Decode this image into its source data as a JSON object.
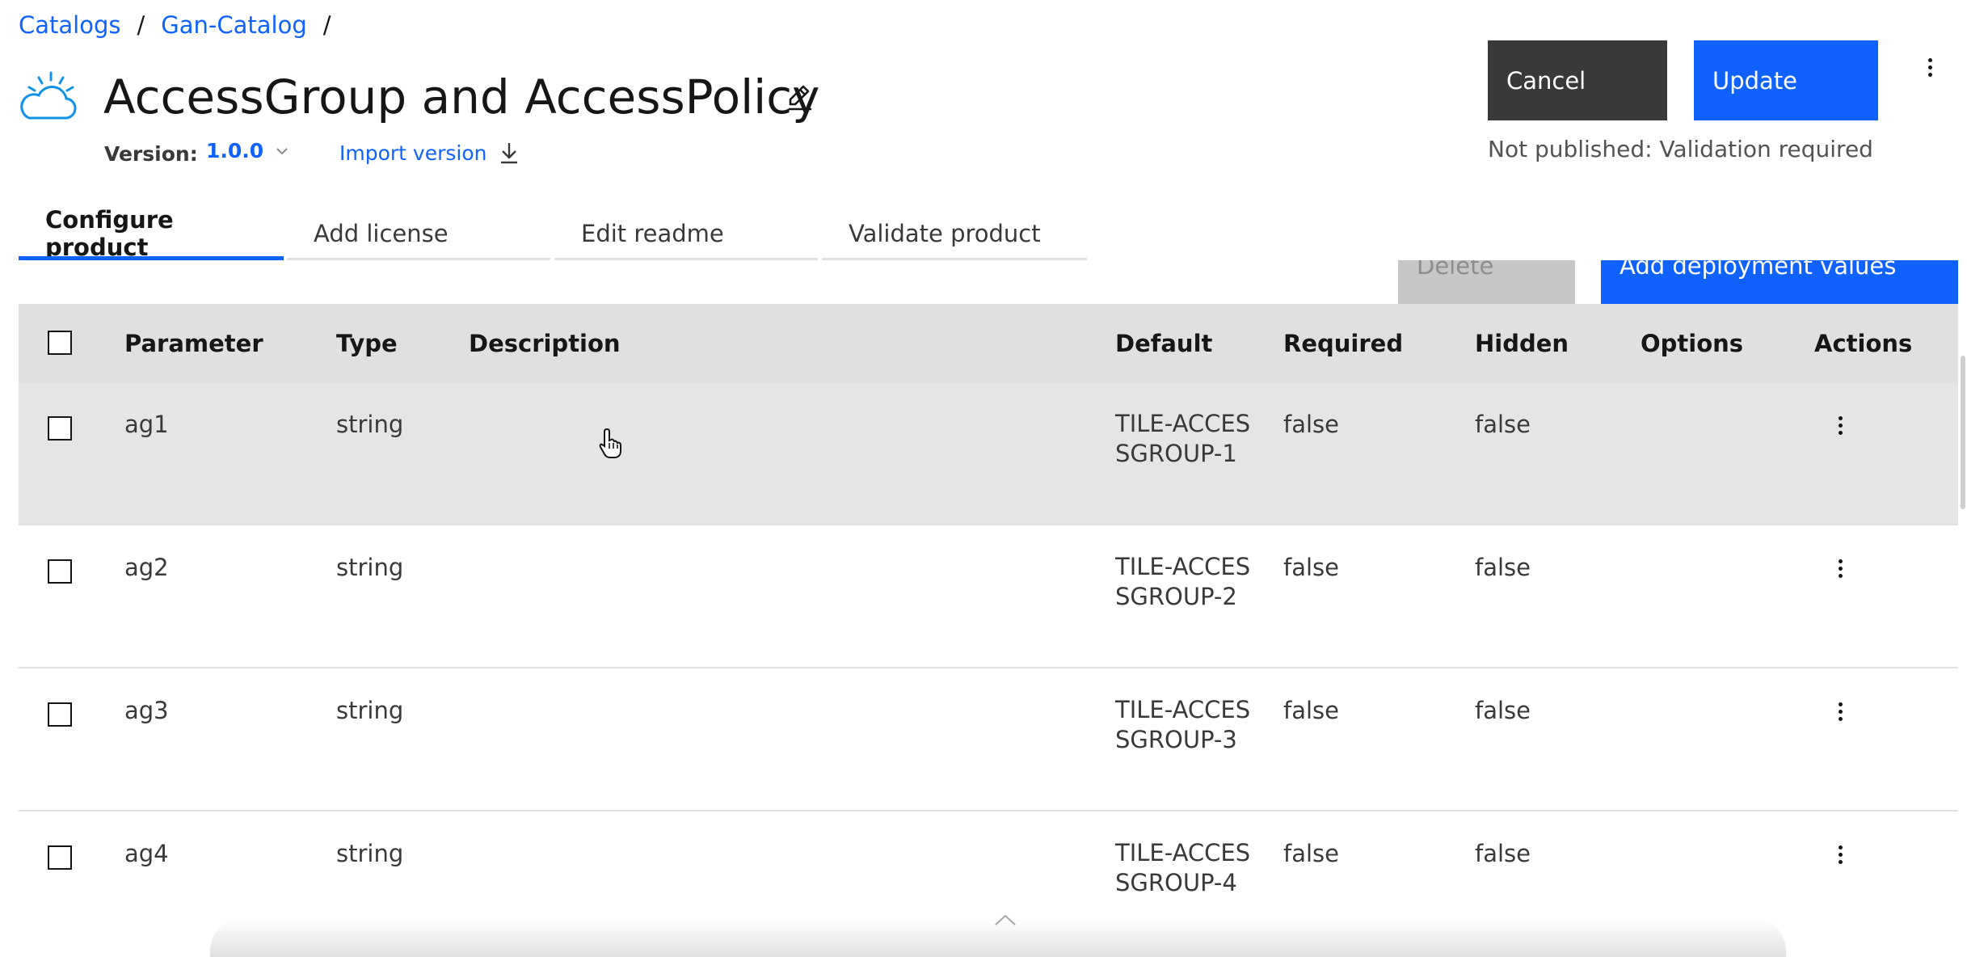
{
  "breadcrumb": {
    "items": [
      "Catalogs",
      "Gan-Catalog"
    ],
    "separator": "/"
  },
  "product": {
    "title": "AccessGroup and AccessPolicy",
    "version_label": "Version:",
    "version_value": "1.0.0",
    "import_version": "Import version"
  },
  "actions": {
    "cancel": "Cancel",
    "update": "Update",
    "status": "Not published: Validation required"
  },
  "tabs": [
    "Configure product",
    "Add license",
    "Edit readme",
    "Validate product"
  ],
  "toolbar": {
    "delete": "Delete",
    "add_deployment_values": "Add deployment values"
  },
  "table": {
    "columns": [
      "Parameter",
      "Type",
      "Description",
      "Default",
      "Required",
      "Hidden",
      "Options",
      "Actions"
    ],
    "rows": [
      {
        "parameter": "ag1",
        "type": "string",
        "description": "",
        "default": "TILE-ACCESSGROUP-1",
        "required": "false",
        "hidden": "false",
        "options": ""
      },
      {
        "parameter": "ag2",
        "type": "string",
        "description": "",
        "default": "TILE-ACCESSGROUP-2",
        "required": "false",
        "hidden": "false",
        "options": ""
      },
      {
        "parameter": "ag3",
        "type": "string",
        "description": "",
        "default": "TILE-ACCESSGROUP-3",
        "required": "false",
        "hidden": "false",
        "options": ""
      },
      {
        "parameter": "ag4",
        "type": "string",
        "description": "",
        "default": "TILE-ACCESSGROUP-4",
        "required": "false",
        "hidden": "false",
        "options": ""
      }
    ]
  },
  "colors": {
    "primary": "#0f62fe",
    "secondary": "#393939",
    "disabled": "#c6c6c6",
    "header_bg": "#e0e0e0",
    "hover_bg": "#e5e5e5"
  },
  "icons": [
    "cloud-icon",
    "edit-icon",
    "chevron-down-icon",
    "download-icon",
    "overflow-menu-icon",
    "pointer-cursor-icon",
    "chevron-up-icon"
  ]
}
